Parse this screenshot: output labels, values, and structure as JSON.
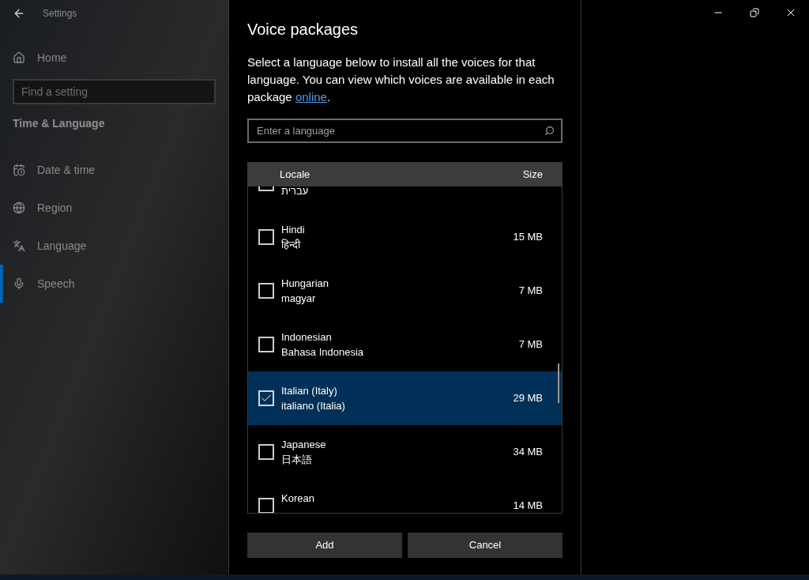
{
  "settings": {
    "title": "Settings",
    "home": "Home",
    "search": {
      "placeholder": "Find a setting"
    },
    "section": "Time & Language",
    "items": [
      {
        "label": "Date & time",
        "kind": "calendar",
        "selected": false
      },
      {
        "label": "Region",
        "kind": "globe",
        "selected": false
      },
      {
        "label": "Language",
        "kind": "language",
        "selected": false
      },
      {
        "label": "Speech",
        "kind": "mic",
        "selected": true
      }
    ]
  },
  "dialog": {
    "title": "Voice packages",
    "description": "Select a language below to install all the voices for that language. You can view which voices are available in each package ",
    "link": "online",
    "after_link": ".",
    "search": {
      "placeholder": "Enter a language"
    },
    "columns": [
      "Locale",
      "Size"
    ],
    "rows": [
      {
        "native": "עברית",
        "checked": false
      },
      {
        "name": "Hindi",
        "native": "हिन्दी",
        "size": "15 MB",
        "checked": false,
        "selected": false
      },
      {
        "name": "Hungarian",
        "native": "magyar",
        "size": "7 MB",
        "checked": false,
        "selected": false
      },
      {
        "name": "Indonesian",
        "native": "Bahasa Indonesia",
        "size": "7 MB",
        "checked": false,
        "selected": false
      },
      {
        "name": "Italian (Italy)",
        "native": "italiano (Italia)",
        "size": "29 MB",
        "checked": true,
        "selected": true
      },
      {
        "name": "Japanese",
        "native": "日本語",
        "size": "34 MB",
        "checked": false,
        "selected": false
      },
      {
        "name": "Korean",
        "size": "14 MB",
        "checked": false,
        "selected": false
      }
    ],
    "buttons": [
      "Add",
      "Cancel"
    ]
  }
}
